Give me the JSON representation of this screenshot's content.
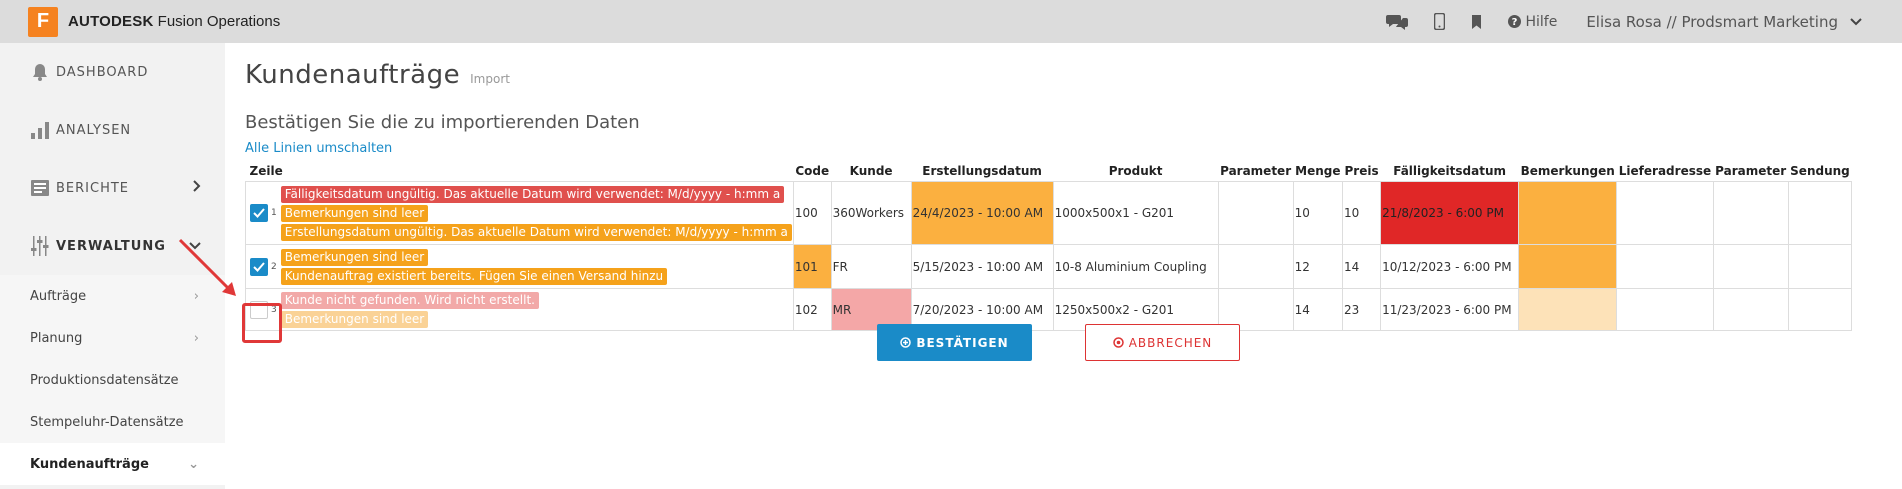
{
  "topbar": {
    "logo_letter": "F",
    "brand_bold": "AUTODESK",
    "brand_rest": " Fusion Operations",
    "help_label": "Hilfe",
    "user_label": "Elisa Rosa // Prodsmart Marketing"
  },
  "sidebar": {
    "items": [
      {
        "label": "DASHBOARD",
        "icon": "bell-icon"
      },
      {
        "label": "ANALYSEN",
        "icon": "bar-chart-icon"
      },
      {
        "label": "BERICHTE",
        "icon": "reports-icon"
      },
      {
        "label": "VERWALTUNG",
        "icon": "sliders-icon"
      }
    ],
    "sub_items": [
      {
        "label": "Aufträge"
      },
      {
        "label": "Planung"
      },
      {
        "label": "Produktionsdatensätze"
      },
      {
        "label": "Stempeluhr-Datensätze"
      },
      {
        "label": "Kundenaufträge"
      }
    ]
  },
  "page": {
    "title": "Kundenaufträge",
    "subtitle": "Import",
    "section_title": "Bestätigen Sie die zu importierenden Daten",
    "toggle_all": "Alle Linien umschalten"
  },
  "table": {
    "headers": [
      "Zeile",
      "Code",
      "Kunde",
      "Erstellungsdatum",
      "Produkt",
      "Parameter",
      "Menge",
      "Preis",
      "Fälligkeitsdatum",
      "Bemerkungen",
      "Lieferadresse",
      "Parameter",
      "Sendung"
    ],
    "rows": [
      {
        "row_number": "1",
        "checked": true,
        "messages": [
          {
            "text": "Fälligkeitsdatum ungültig. Das aktuelle Datum wird verwendet: M/d/yyyy - h:mm a",
            "type": "red"
          },
          {
            "text": "Bemerkungen sind leer",
            "type": "orange"
          },
          {
            "text": "Erstellungsdatum ungültig. Das aktuelle Datum wird verwendet: M/d/yyyy - h:mm a",
            "type": "orange"
          }
        ],
        "code": "100",
        "kunde": "360Workers",
        "erstellungsdatum": "24/4/2023 - 10:00 AM",
        "produkt": "1000x500x1 - G201",
        "parameter": "",
        "menge": "10",
        "preis": "10",
        "faelligkeitsdatum": "21/8/2023 - 6:00 PM",
        "bemerkungen": "",
        "lieferadresse": "",
        "parameter2": "",
        "sendung": ""
      },
      {
        "row_number": "2",
        "checked": true,
        "messages": [
          {
            "text": "Bemerkungen sind leer",
            "type": "orange"
          },
          {
            "text": "Kundenauftrag existiert bereits. Fügen Sie einen Versand hinzu",
            "type": "orange"
          }
        ],
        "code": "101",
        "kunde": "FR",
        "erstellungsdatum": "5/15/2023 - 10:00 AM",
        "produkt": "10-8 Aluminium Coupling",
        "parameter": "",
        "menge": "12",
        "preis": "14",
        "faelligkeitsdatum": "10/12/2023 - 6:00 PM",
        "bemerkungen": "",
        "lieferadresse": "",
        "parameter2": "",
        "sendung": ""
      },
      {
        "row_number": "3",
        "checked": false,
        "messages": [
          {
            "text": "Kunde nicht gefunden. Wird nicht erstellt.",
            "type": "red"
          },
          {
            "text": "Bemerkungen sind leer",
            "type": "orange"
          }
        ],
        "code": "102",
        "kunde": "MR",
        "erstellungsdatum": "7/20/2023 - 10:00 AM",
        "produkt": "1250x500x2 - G201",
        "parameter": "",
        "menge": "14",
        "preis": "23",
        "faelligkeitsdatum": "11/23/2023 - 6:00 PM",
        "bemerkungen": "",
        "lieferadresse": "",
        "parameter2": "",
        "sendung": ""
      }
    ]
  },
  "buttons": {
    "confirm": "BESTÄTIGEN",
    "cancel": "ABBRECHEN"
  },
  "colors": {
    "accent": "#1a8bc8",
    "warning": "#fbb040",
    "error": "#e02727",
    "logo": "#f58220"
  }
}
